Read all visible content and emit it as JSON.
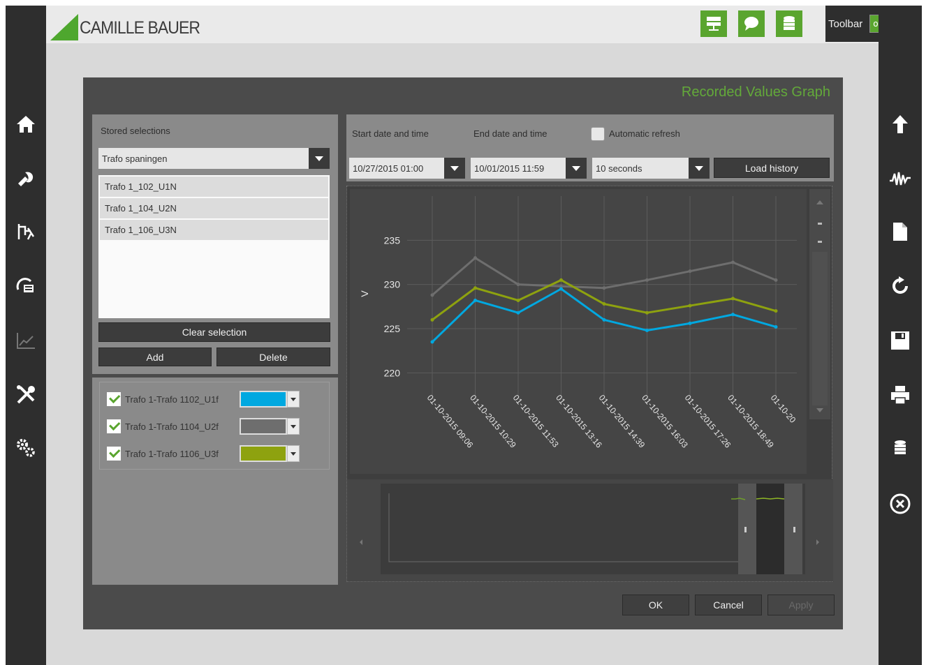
{
  "brand": {
    "name": "CAMILLE BAUER"
  },
  "toolbar": {
    "label": "Toolbar",
    "toggle": "on"
  },
  "header_icons": [
    "network-icon",
    "chat-icon",
    "database-icon"
  ],
  "left_nav": [
    "home-icon",
    "tools-fire-icon",
    "measurement-icon",
    "meter-icon",
    "trend-icon",
    "wrench-screwdriver-icon",
    "settings-gears-icon"
  ],
  "right_nav": [
    "upload-icon",
    "waveform-icon",
    "document-icon",
    "refresh-icon",
    "save-icon",
    "print-icon",
    "database-icon",
    "close-circle-icon"
  ],
  "dialog": {
    "title": "Recorded Values Graph",
    "stored_label": "Stored selections",
    "stored_value": "Trafo spaningen",
    "selection_items": [
      "Trafo 1_102_U1N",
      "Trafo 1_104_U2N",
      "Trafo 1_106_U3N"
    ],
    "clear_label": "Clear selection",
    "add_label": "Add",
    "delete_label": "Delete",
    "series": [
      {
        "label": "Trafo 1-Trafo 1102_U1f",
        "color": "#00a8e0",
        "checked": true
      },
      {
        "label": "Trafo 1-Trafo 1104_U2f",
        "color": "#6e6e6e",
        "checked": true
      },
      {
        "label": "Trafo 1-Trafo 1106_U3f",
        "color": "#8ea20f",
        "checked": true
      }
    ],
    "start_label": "Start date and time",
    "end_label": "End date and time",
    "auto_refresh_label": "Automatic refresh",
    "auto_refresh_checked": false,
    "start_value": "10/27/2015 01:00",
    "end_value": "10/01/2015 11:59",
    "interval_value": "10 seconds",
    "load_label": "Load history",
    "ok_label": "OK",
    "cancel_label": "Cancel",
    "apply_label": "Apply"
  },
  "chart_data": {
    "type": "line",
    "ylabel": "V",
    "ylim": [
      217.5,
      240
    ],
    "yticks": [
      "235",
      "230",
      "225",
      "220"
    ],
    "x": [
      "01-10-2015 09:06",
      "01-10-2015 10:29",
      "01-10-2015 11:53",
      "01-10-2015 13:16",
      "01-10-2015 14:39",
      "01-10-2015 16:03",
      "01-10-2015 17:26",
      "01-10-2015 18:49",
      "01-10-20"
    ],
    "series": [
      {
        "name": "Trafo 1-Trafo 1102_U1f",
        "color": "#00a8e0",
        "values": [
          223.5,
          228.2,
          226.8,
          229.5,
          226.0,
          224.8,
          225.6,
          226.6,
          225.2
        ]
      },
      {
        "name": "Trafo 1-Trafo 1104_U2f",
        "color": "#6e6e6e",
        "values": [
          228.8,
          233.0,
          230.0,
          229.8,
          229.6,
          230.5,
          231.5,
          232.5,
          230.5
        ]
      },
      {
        "name": "Trafo 1-Trafo 1106_U3f",
        "color": "#8ea20f",
        "values": [
          226.0,
          229.6,
          228.2,
          230.5,
          227.8,
          226.8,
          227.6,
          228.4,
          227.0
        ]
      }
    ],
    "grid": true
  }
}
